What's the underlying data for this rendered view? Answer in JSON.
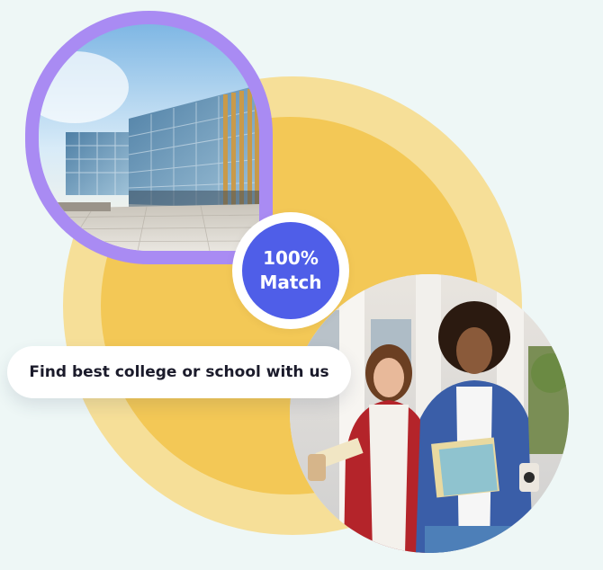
{
  "badge": {
    "line1": "100%",
    "line2": "Match"
  },
  "tagline": "Find best college or school with us",
  "colors": {
    "background": "#eef7f6",
    "yellow_outer": "#f6df98",
    "yellow_inner": "#f3c856",
    "purple_frame": "#a98bf3",
    "badge_blue": "#4f5ee8"
  },
  "images": {
    "building": "modern-glass-building-photo",
    "students": "two-students-with-books-photo"
  }
}
